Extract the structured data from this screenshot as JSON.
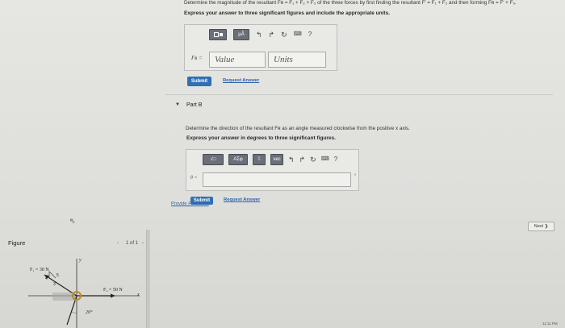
{
  "part_a": {
    "instruction": "Determine the magnitude of the resultant Fʀ = F₁ + F₂ + F₃ of the three forces by first finding the resultant F′ = F₁ + F₂ and then forming Fʀ = F′ + F₃.",
    "express": "Express your answer to three significant figures and include the appropriate units.",
    "variable": "Fʀ =",
    "value_placeholder": "Value",
    "units_placeholder": "Units",
    "submit": "Submit",
    "request": "Request Answer",
    "help": "?"
  },
  "part_b": {
    "title": "Part B",
    "instruction": "Determine the direction of the resultant Fʀ as an angle measured clockwise from the positive x axis.",
    "express": "Express your answer in degrees to three significant figures.",
    "variable": "θ =",
    "degree": "°",
    "tb_sqrt": "√□",
    "tb_greek": "AΣφ",
    "tb_vec": "vec",
    "help": "?",
    "submit": "Submit",
    "request": "Request Answer"
  },
  "footer": {
    "feedback": "Provide Feedback",
    "next": "Next ❯"
  },
  "figure": {
    "label": "Figure",
    "pager": "1 of 1",
    "prev": "‹",
    "next": "›",
    "f1_label": "F₁ = 30 N",
    "f2_label": "F₂ = 50 N",
    "angle": "20°",
    "num5": "5",
    "num4": "4",
    "num3": "3",
    "y_axis": "y",
    "x_axis": "x"
  },
  "status": {
    "clock": "11:11 PM"
  }
}
